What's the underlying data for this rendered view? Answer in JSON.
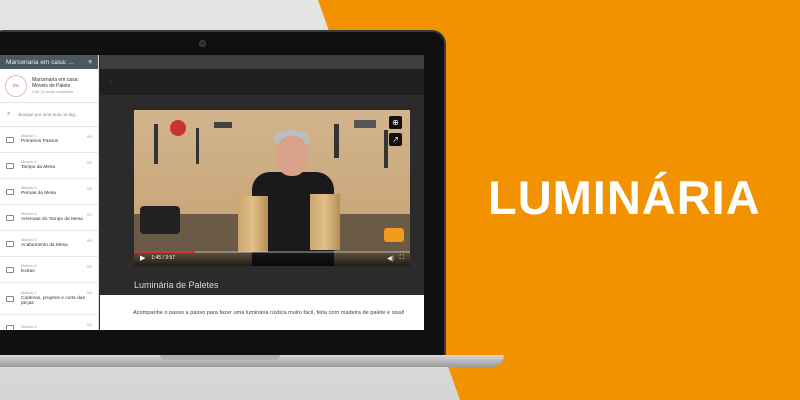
{
  "promo": {
    "title": "LUMINÁRIA"
  },
  "sidebar": {
    "header_title": "Marcenaria em casa: ...",
    "menu_icon": "menu-icon",
    "progress_percent": "0%",
    "course_name": "Marcenaria em casa: Móveis de Palete",
    "progress_text": "0 de 24 aulas completas",
    "search_placeholder": "Busque por uma aula ou tag...",
    "modules": [
      {
        "label": "Módulo 1",
        "name": "Primeiros Passos",
        "count": "0/2"
      },
      {
        "label": "Módulo 2",
        "name": "Tampo da Mesa",
        "count": "0/2"
      },
      {
        "label": "Módulo 3",
        "name": "Pernas da Mesa",
        "count": "0/5"
      },
      {
        "label": "Módulo 4",
        "name": "Arremate do Tampo da Mesa",
        "count": "0/7"
      },
      {
        "label": "Módulo 5",
        "name": "Acabamento da Mesa",
        "count": "0/3"
      },
      {
        "label": "Módulo 6",
        "name": "Extras",
        "count": "0/3"
      },
      {
        "label": "Módulo 7",
        "name": "Cadeiras, projetos e corte das peças",
        "count": "0/4"
      },
      {
        "label": "Módulo 8",
        "name": "",
        "count": "0/3"
      }
    ]
  },
  "player": {
    "time": "1:45 / 3:57",
    "progress": 0.22,
    "lesson_title": "Luminária de Paletes",
    "description": "Acompanhe o passo a passo para fazer uma luminária rústica muito fácil, feita com madeira de palete e sisal!"
  },
  "colors": {
    "orange": "#f39200",
    "sidebar_header": "#4a5862",
    "progress_red": "#e53935"
  }
}
